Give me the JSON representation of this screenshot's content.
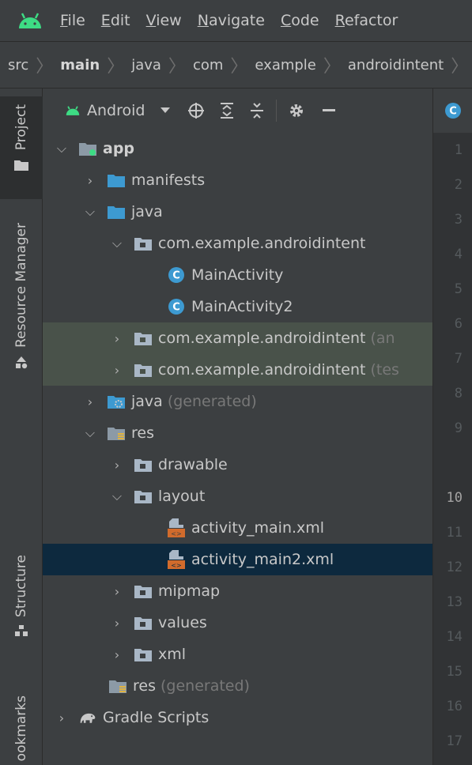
{
  "menu": [
    "File",
    "Edit",
    "View",
    "Navigate",
    "Code",
    "Refactor"
  ],
  "breadcrumb": [
    "src",
    "main",
    "java",
    "com",
    "example",
    "androidintent"
  ],
  "stripe": {
    "project": "Project",
    "resource_manager": "Resource Manager",
    "structure": "Structure",
    "bookmarks": "ookmarks"
  },
  "project_toolbar": {
    "view_name": "Android"
  },
  "tree": {
    "app": "app",
    "manifests": "manifests",
    "java": "java",
    "pkg_main": "com.example.androidintent",
    "main_activity": "MainActivity",
    "main_activity2": "MainActivity2",
    "pkg_android_test": "com.example.androidintent",
    "pkg_android_test_hint": "(an",
    "pkg_test": "com.example.androidintent",
    "pkg_test_hint": "(tes",
    "java_generated": "java",
    "java_generated_hint": "(generated)",
    "res": "res",
    "drawable": "drawable",
    "layout": "layout",
    "activity_main": "activity_main.xml",
    "activity_main2": "activity_main2.xml",
    "mipmap": "mipmap",
    "values": "values",
    "xml": "xml",
    "res_generated": "res",
    "res_generated_hint": "(generated)",
    "gradle_scripts": "Gradle Scripts"
  },
  "gutter_lines": [
    "1",
    "2",
    "3",
    "4",
    "5",
    "6",
    "7",
    "8",
    "9",
    "10",
    "11",
    "12",
    "13",
    "14",
    "15",
    "16",
    "17"
  ],
  "colors": {
    "android_green": "#3ddc84",
    "folder_blue": "#3d9ad1",
    "class_blue": "#3d9ad1",
    "xml_orange": "#d16b2c",
    "selection": "#0d293e",
    "test_green": "#49524a"
  }
}
